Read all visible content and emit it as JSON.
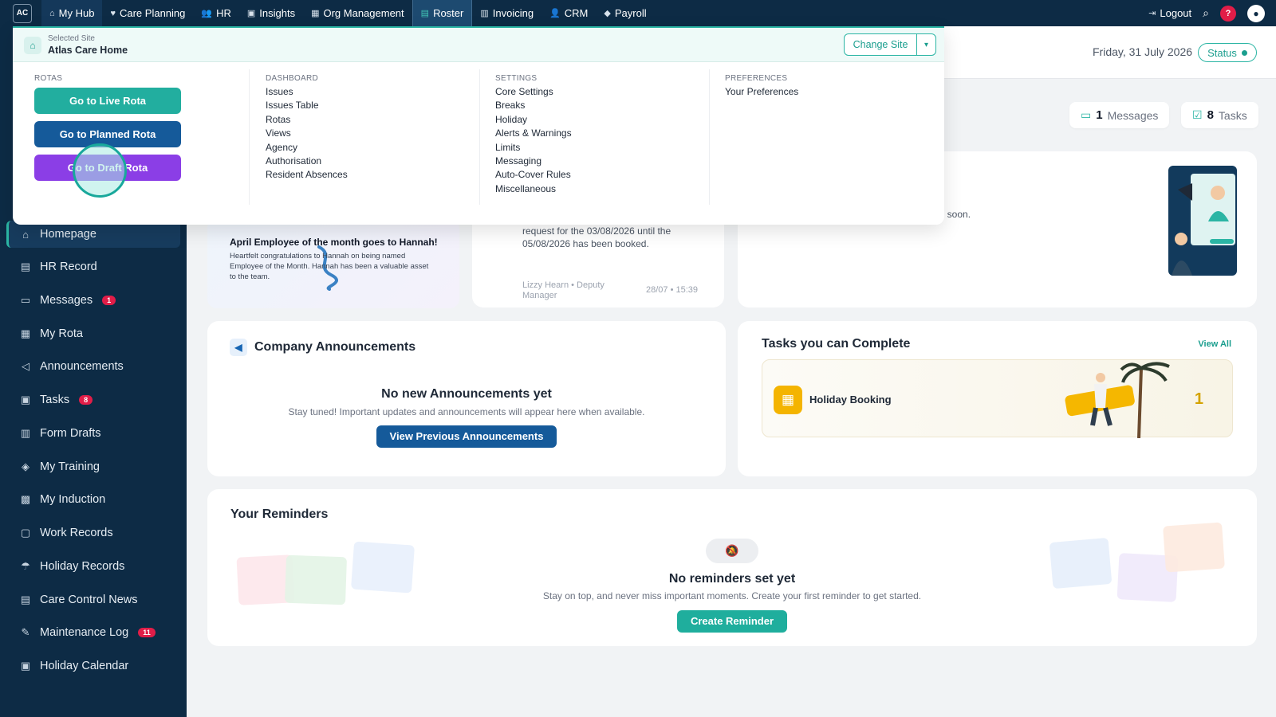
{
  "topnav": {
    "logo": "AC",
    "items": [
      {
        "label": "My Hub",
        "icon": "home-icon"
      },
      {
        "label": "Care Planning",
        "icon": "heart-icon"
      },
      {
        "label": "HR",
        "icon": "people-icon"
      },
      {
        "label": "Insights",
        "icon": "chart-icon"
      },
      {
        "label": "Org Management",
        "icon": "building-icon"
      },
      {
        "label": "Roster",
        "icon": "calendar-icon"
      },
      {
        "label": "Invoicing",
        "icon": "document-icon"
      },
      {
        "label": "CRM",
        "icon": "user-icon"
      },
      {
        "label": "Payroll",
        "icon": "tag-icon"
      }
    ],
    "logout": "Logout",
    "help": "?"
  },
  "dropdown": {
    "site_label": "Selected Site",
    "site_name": "Atlas Care Home",
    "change_site": "Change Site",
    "rotas": {
      "heading": "ROTAS",
      "live": "Go to Live Rota",
      "planned": "Go to Planned Rota",
      "draft": "Go to Draft Rota"
    },
    "dashboard": {
      "heading": "DASHBOARD",
      "links": [
        "Issues",
        "Issues Table",
        "Rotas",
        "Views",
        "Agency",
        "Authorisation",
        "Resident Absences"
      ]
    },
    "settings": {
      "heading": "SETTINGS",
      "links": [
        "Core Settings",
        "Breaks",
        "Holiday",
        "Alerts & Warnings",
        "Limits",
        "Messaging",
        "Auto-Cover Rules",
        "Miscellaneous"
      ]
    },
    "preferences": {
      "heading": "PREFERENCES",
      "links": [
        "Your Preferences"
      ]
    }
  },
  "sidebar": {
    "items": [
      {
        "label": "Homepage",
        "icon": "home-icon",
        "active": true
      },
      {
        "label": "HR Record",
        "icon": "file-icon"
      },
      {
        "label": "Messages",
        "icon": "chat-icon",
        "badge": "1"
      },
      {
        "label": "My Rota",
        "icon": "grid-icon"
      },
      {
        "label": "Announcements",
        "icon": "megaphone-icon"
      },
      {
        "label": "Tasks",
        "icon": "calendar-icon",
        "badge": "8"
      },
      {
        "label": "Form Drafts",
        "icon": "form-icon"
      },
      {
        "label": "My Training",
        "icon": "graduation-cap-icon"
      },
      {
        "label": "My Induction",
        "icon": "checklist-icon"
      },
      {
        "label": "Work Records",
        "icon": "briefcase-icon"
      },
      {
        "label": "Holiday Records",
        "icon": "umbrella-icon"
      },
      {
        "label": "Care Control News",
        "icon": "news-icon"
      },
      {
        "label": "Maintenance Log",
        "icon": "wrench-icon",
        "badge": "11"
      },
      {
        "label": "Holiday Calendar",
        "icon": "calendar-icon"
      }
    ]
  },
  "header": {
    "date": "Friday, 31 July 2026",
    "status": "Status"
  },
  "counters": {
    "messages_count": "1",
    "messages_label": "Messages",
    "tasks_count": "8",
    "tasks_label": "Tasks"
  },
  "employee_card": {
    "title": "April Employee of the month goes to Hannah!",
    "body": "Heartfelt congratulations to Hannah on being named Employee of the Month. Hannah has been a valuable asset to the team."
  },
  "holiday_card": {
    "text": "request for the 03/08/2026 until the 05/08/2026 has been booked.",
    "author": "Lizzy Hearn • Deputy Manager",
    "time": "28/07 • 15:39"
  },
  "news_card": {
    "text": "ews soon."
  },
  "announcements": {
    "title": "Company Announcements",
    "empty_title": "No new Announcements yet",
    "empty_sub": "Stay tuned! Important updates and announcements will appear here when available.",
    "button": "View Previous Announcements"
  },
  "tasks": {
    "title": "Tasks you can Complete",
    "view_all": "View All",
    "row_label": "Holiday Booking",
    "row_count": "1"
  },
  "reminders": {
    "title": "Your Reminders",
    "empty_title": "No reminders set yet",
    "empty_sub": "Stay on top, and never miss important moments. Create your first reminder to get started.",
    "button": "Create Reminder"
  },
  "colors": {
    "nav_bg": "#0d2b45",
    "accent_teal": "#2bb5a4",
    "primary_blue": "#155a9a",
    "draft_purple": "#8b3ee6",
    "badge_red": "#e11d48"
  }
}
